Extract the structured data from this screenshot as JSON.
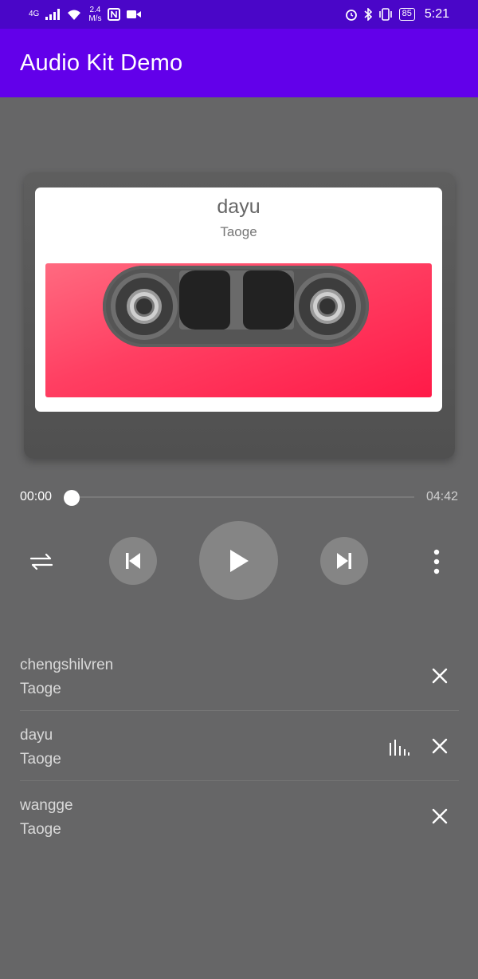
{
  "status_bar": {
    "network": "4G",
    "speed_value": "2.4",
    "speed_unit": "M/s",
    "battery": "85",
    "time": "5:21",
    "icons": [
      "signal-icon",
      "wifi-icon",
      "nfc-icon",
      "video-icon",
      "alarm-icon",
      "bluetooth-icon",
      "vibrate-icon",
      "battery-icon"
    ]
  },
  "app_bar": {
    "title": "Audio Kit Demo",
    "color": "#6200ea"
  },
  "now_playing": {
    "title": "dayu",
    "artist": "Taoge",
    "current_time": "00:00",
    "total_time": "04:42",
    "progress": 0
  },
  "controls": {
    "shuffle_icon": "repeat-list-icon",
    "prev_icon": "skip-previous-icon",
    "play_icon": "play-icon",
    "next_icon": "skip-next-icon",
    "more_icon": "more-vertical-icon"
  },
  "playlist": [
    {
      "title": "chengshilvren",
      "artist": "Taoge",
      "playing": false
    },
    {
      "title": "dayu",
      "artist": "Taoge",
      "playing": true
    },
    {
      "title": "wangge",
      "artist": "Taoge",
      "playing": false
    }
  ]
}
